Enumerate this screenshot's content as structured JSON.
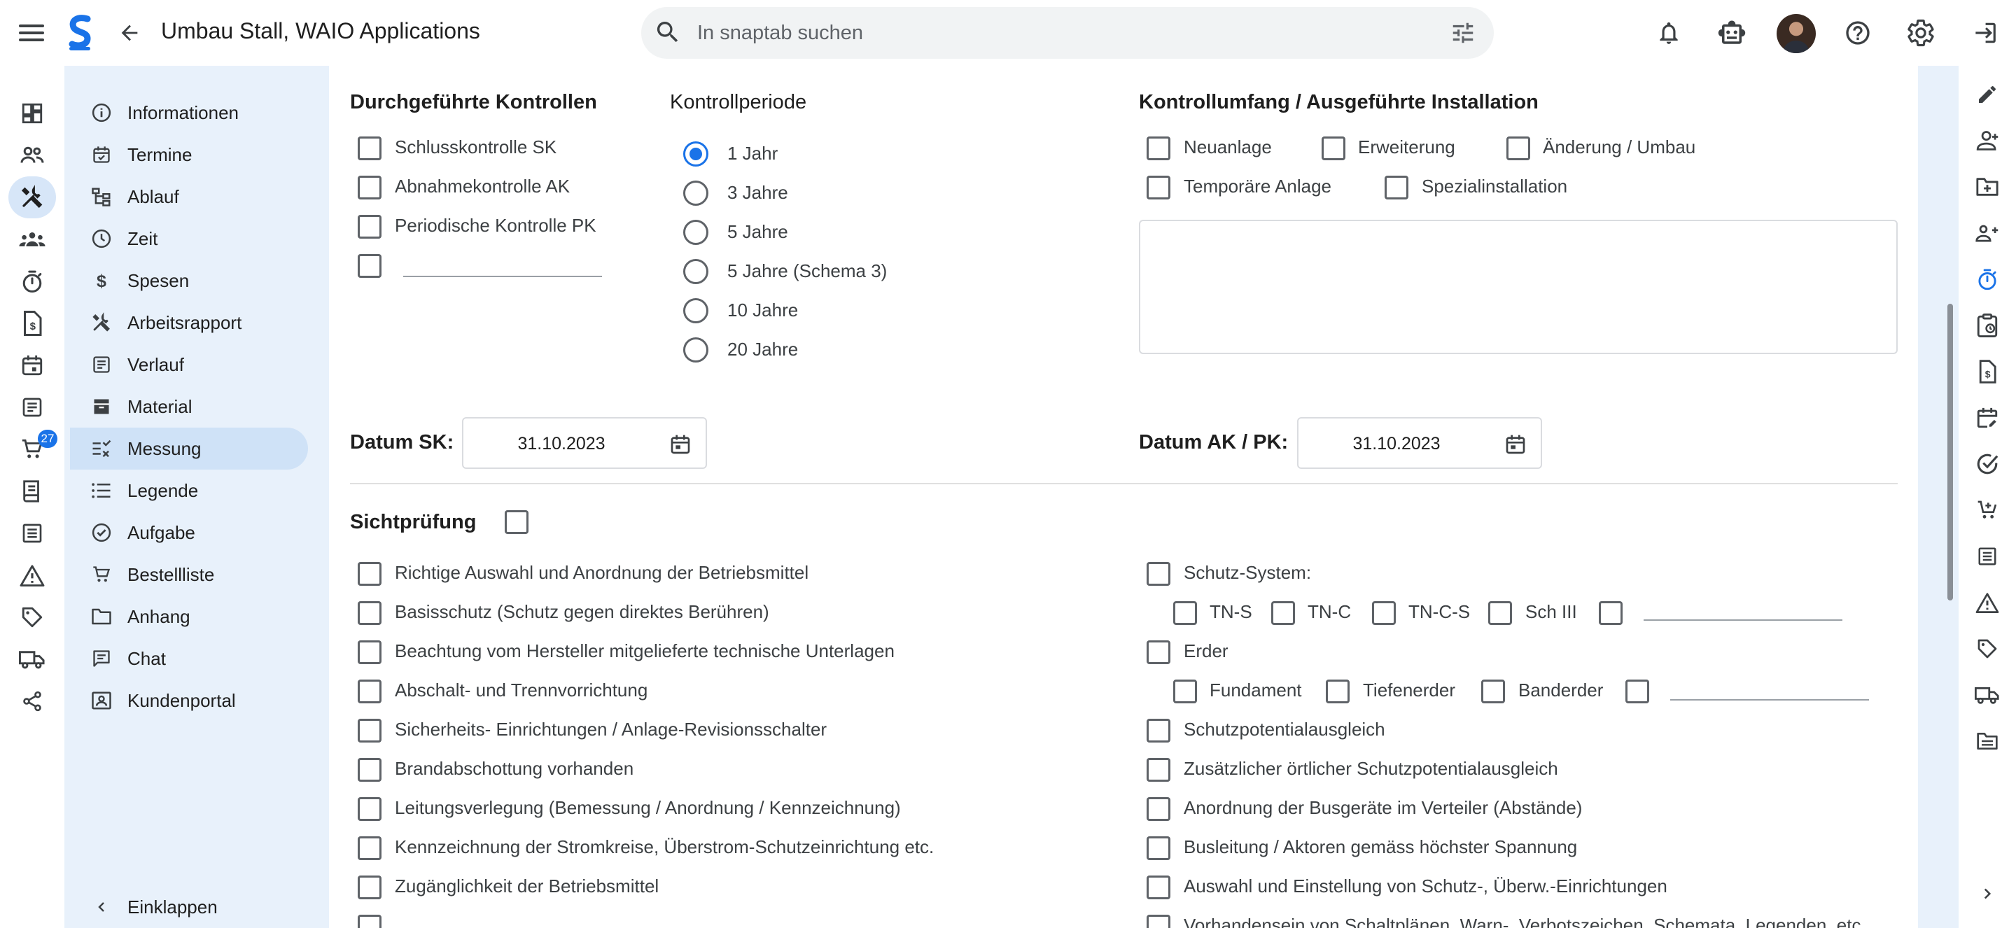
{
  "header": {
    "title": "Umbau Stall, WAIO Applications",
    "search_placeholder": "In snaptab suchen"
  },
  "rail": {
    "cart_badge": "27",
    "icons": [
      "dashboard-icon",
      "people-icon",
      "tools-icon",
      "groups-icon",
      "timer-icon",
      "document-icon",
      "calendar-icon",
      "notes-icon",
      "cart-icon",
      "book-icon",
      "list-icon",
      "warning-icon",
      "tag-icon",
      "truck-icon",
      "share-icon"
    ]
  },
  "subnav": {
    "items": [
      {
        "label": "Informationen",
        "icon": "info-icon"
      },
      {
        "label": "Termine",
        "icon": "calendar-check-icon"
      },
      {
        "label": "Ablauf",
        "icon": "tree-icon"
      },
      {
        "label": "Zeit",
        "icon": "clock-icon"
      },
      {
        "label": "Spesen",
        "icon": "dollar-icon"
      },
      {
        "label": "Arbeitsrapport",
        "icon": "tools-icon"
      },
      {
        "label": "Verlauf",
        "icon": "history-icon"
      },
      {
        "label": "Material",
        "icon": "box-icon"
      },
      {
        "label": "Messung",
        "icon": "rule-icon"
      },
      {
        "label": "Legende",
        "icon": "list-icon"
      },
      {
        "label": "Aufgabe",
        "icon": "check-circle-icon"
      },
      {
        "label": "Bestellliste",
        "icon": "cart-icon"
      },
      {
        "label": "Anhang",
        "icon": "folder-icon"
      },
      {
        "label": "Chat",
        "icon": "chat-icon"
      },
      {
        "label": "Kundenportal",
        "icon": "portal-icon"
      }
    ],
    "active": "Messung",
    "collapse_label": "Einklappen"
  },
  "kontrollen": {
    "title": "Durchgeführte Kontrollen",
    "items": [
      "Schlusskontrolle SK",
      "Abnahmekontrolle AK",
      "Periodische Kontrolle PK",
      ""
    ]
  },
  "periode": {
    "title": "Kontrollperiode",
    "options": [
      "1 Jahr",
      "3 Jahre",
      "5 Jahre",
      "5 Jahre (Schema 3)",
      "10 Jahre",
      "20 Jahre"
    ],
    "selected": "1 Jahr"
  },
  "umfang": {
    "title": "Kontrollumfang / Ausgeführte Installation",
    "row1": [
      "Neuanlage",
      "Erweiterung",
      "Änderung / Umbau"
    ],
    "row2": [
      "Temporäre Anlage",
      "Spezialinstallation"
    ],
    "notes": ""
  },
  "dates": {
    "sk_label": "Datum SK:",
    "sk_value": "31.10.2023",
    "akpk_label": "Datum AK / PK:",
    "akpk_value": "31.10.2023"
  },
  "sicht": {
    "title": "Sichtprüfung",
    "left": [
      "Richtige Auswahl und Anordnung der Betriebsmittel",
      "Basisschutz (Schutz gegen direktes Berühren)",
      "Beachtung vom Hersteller mitgelieferte technische Unterlagen",
      "Abschalt- und Trennvorrichtung",
      "Sicherheits- Einrichtungen / Anlage-Revisionsschalter",
      "Brandabschottung vorhanden",
      "Leitungsverlegung (Bemessung / Anordnung / Kennzeichnung)",
      "Kennzeichnung der Stromkreise, Überstrom-Schutzeinrichtung etc.",
      "Zugänglichkeit der Betriebsmittel"
    ],
    "schutz_label": "Schutz-System:",
    "schutz_opts": [
      "TN-S",
      "TN-C",
      "TN-C-S",
      "Sch III"
    ],
    "erder_label": "Erder",
    "erder_opts": [
      "Fundament",
      "Tiefenerder",
      "Banderder"
    ],
    "right": [
      "Schutzpotentialausgleich",
      "Zusätzlicher örtlicher Schutzpotentialausgleich",
      "Anordnung der Busgeräte im Verteiler (Abstände)",
      "Busleitung / Aktoren gemäss höchster Spannung",
      "Auswahl und Einstellung von Schutz-, Überw.-Einrichtungen",
      "Vorhandensein von Schaltplänen, Warn-, Verbotszeichen, Schemata, Legenden, etc."
    ]
  },
  "right_rail": {
    "icons": [
      "edit-icon",
      "person-add-icon",
      "folder-add-icon",
      "group-add-icon",
      "timer-icon",
      "clipboard-icon",
      "invoice-icon",
      "calendar-edit-icon",
      "task-done-icon",
      "cart-add-icon",
      "list-icon",
      "warning-icon",
      "tag-icon",
      "truck-icon",
      "folder-open-icon",
      "chevron-right-icon"
    ]
  },
  "colors": {
    "accent": "#1a73e8",
    "nav_bg": "#e8f1fb",
    "active_bg": "#cfe2f7"
  }
}
